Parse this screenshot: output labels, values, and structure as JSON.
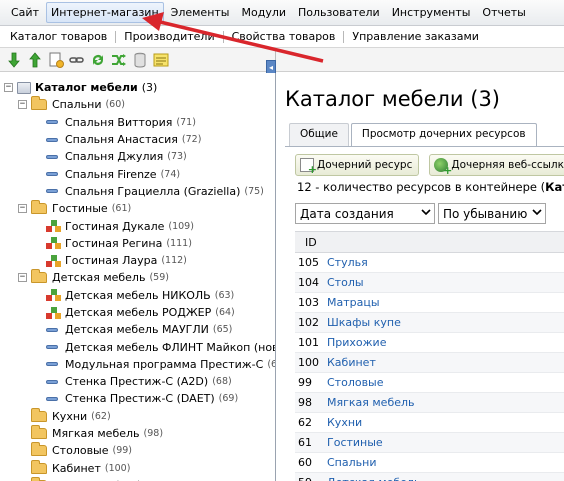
{
  "menubar": {
    "items": [
      "Сайт",
      "Интернет-магазин",
      "Элементы",
      "Модули",
      "Пользователи",
      "Инструменты",
      "Отчеты"
    ],
    "active_index": 1
  },
  "submenu": {
    "items": [
      "Каталог товаров",
      "Производители",
      "Свойства товаров",
      "Управление заказами"
    ]
  },
  "toolbar": {
    "icons": [
      "arrow-down-icon",
      "arrow-up-icon",
      "new-document-icon",
      "link-icon",
      "refresh-icon",
      "shuffle-icon",
      "trash-icon",
      "notes-icon"
    ]
  },
  "tree": {
    "root": {
      "label": "Каталог мебели",
      "count": "(3)"
    },
    "nodes": [
      {
        "level": 1,
        "type": "folder",
        "toggle": "−",
        "label": "Спальни",
        "count": "(60)"
      },
      {
        "level": 2,
        "type": "doc",
        "label": "Спальня Виттория",
        "count": "(71)"
      },
      {
        "level": 2,
        "type": "doc",
        "label": "Спальня Анастасия",
        "count": "(72)"
      },
      {
        "level": 2,
        "type": "doc",
        "label": "Спальня Джулия",
        "count": "(73)"
      },
      {
        "level": 2,
        "type": "doc",
        "label": "Спальня Firenze",
        "count": "(74)"
      },
      {
        "level": 2,
        "type": "doc",
        "label": "Спальня Грациелла (Graziella)",
        "count": "(75)"
      },
      {
        "level": 1,
        "type": "folder",
        "toggle": "−",
        "label": "Гостиные",
        "count": "(61)"
      },
      {
        "level": 2,
        "type": "cube",
        "label": "Гостиная Дукале",
        "count": "(109)"
      },
      {
        "level": 2,
        "type": "cube",
        "label": "Гостиная Регина",
        "count": "(111)"
      },
      {
        "level": 2,
        "type": "cube",
        "label": "Гостиная Лаура",
        "count": "(112)"
      },
      {
        "level": 1,
        "type": "folder",
        "toggle": "−",
        "label": "Детская мебель",
        "count": "(59)"
      },
      {
        "level": 2,
        "type": "cube",
        "label": "Детская мебель НИКОЛЬ",
        "count": "(63)"
      },
      {
        "level": 2,
        "type": "cube",
        "label": "Детская мебель РОДЖЕР",
        "count": "(64)"
      },
      {
        "level": 2,
        "type": "doc",
        "label": "Детская мебель МАУГЛИ",
        "count": "(65)"
      },
      {
        "level": 2,
        "type": "doc",
        "label": "Детская мебель ФЛИНТ Майкоп (новый)",
        "count": "(66)"
      },
      {
        "level": 2,
        "type": "doc",
        "label": "Модульная программа Престиж-С",
        "count": "(67)"
      },
      {
        "level": 2,
        "type": "doc",
        "label": "Стенка Престиж-С (A2D)",
        "count": "(68)"
      },
      {
        "level": 2,
        "type": "doc",
        "label": "Стенка Престиж-С (DAET)",
        "count": "(69)"
      },
      {
        "level": 1,
        "type": "folder",
        "toggle": "",
        "label": "Кухни",
        "count": "(62)"
      },
      {
        "level": 1,
        "type": "folder",
        "toggle": "",
        "label": "Мягкая мебель",
        "count": "(98)"
      },
      {
        "level": 1,
        "type": "folder",
        "toggle": "",
        "label": "Столовые",
        "count": "(99)"
      },
      {
        "level": 1,
        "type": "folder",
        "toggle": "",
        "label": "Кабинет",
        "count": "(100)"
      },
      {
        "level": 1,
        "type": "folder",
        "toggle": "",
        "label": "Прихожие",
        "count": "(101)"
      }
    ]
  },
  "main": {
    "title": "Каталог мебели",
    "title_count": "(3)",
    "tabs": [
      "Общие",
      "Просмотр дочерних ресурсов"
    ],
    "active_tab": 1,
    "buttons": {
      "child_resource": "Дочерний ресурс",
      "child_weblink": "Дочерняя веб-ссылка"
    },
    "info_text": "12 - количество ресурсов в контейнере (",
    "info_bold": "Катал",
    "sort_field": "Дата создания",
    "sort_order": "По убыванию",
    "table": {
      "header_id": "ID",
      "rows": [
        {
          "id": "105",
          "name": "Стулья"
        },
        {
          "id": "104",
          "name": "Столы"
        },
        {
          "id": "103",
          "name": "Матрацы"
        },
        {
          "id": "102",
          "name": "Шкафы купе"
        },
        {
          "id": "101",
          "name": "Прихожие"
        },
        {
          "id": "100",
          "name": "Кабинет"
        },
        {
          "id": "99",
          "name": "Столовые"
        },
        {
          "id": "98",
          "name": "Мягкая мебель"
        },
        {
          "id": "62",
          "name": "Кухни"
        },
        {
          "id": "61",
          "name": "Гостиные"
        },
        {
          "id": "60",
          "name": "Спальни"
        },
        {
          "id": "59",
          "name": "Детская мебель"
        }
      ]
    }
  },
  "annotation": {
    "arrow_color": "#d9262c"
  }
}
